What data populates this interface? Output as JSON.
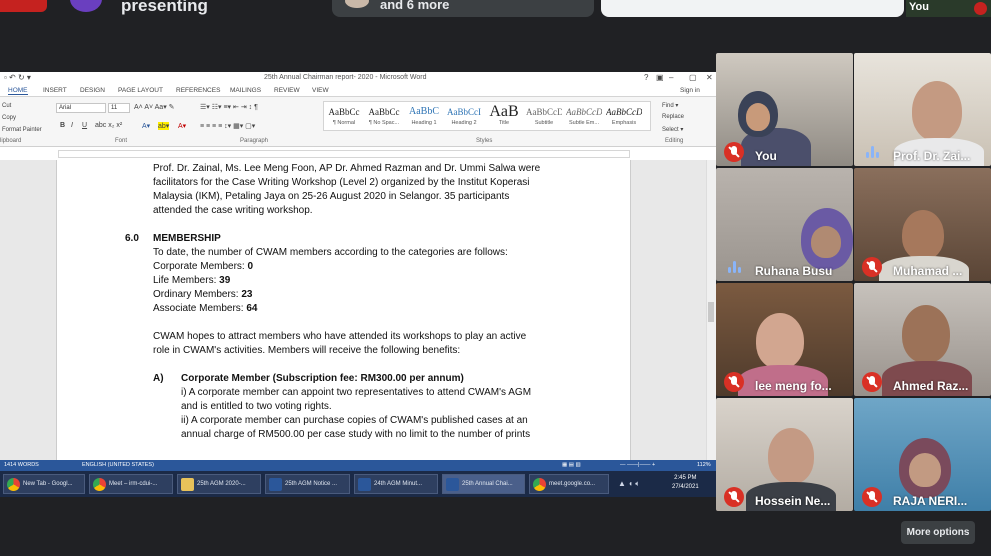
{
  "meet": {
    "presenting_label": "presenting",
    "participants_more": "and 6 more",
    "self_mini_label": "You",
    "more_options_label": "More options"
  },
  "word": {
    "title": "25th Annual Chairman report- 2020 - Microsoft Word",
    "window_controls": [
      "?",
      "▣",
      "–",
      "▢",
      "✕"
    ],
    "sign_in": "Sign in",
    "tabs": [
      "HOME",
      "INSERT",
      "DESIGN",
      "PAGE LAYOUT",
      "REFERENCES",
      "MAILINGS",
      "REVIEW",
      "VIEW"
    ],
    "clipboard": [
      "Cut",
      "Copy",
      "Format Painter"
    ],
    "font_name": "Arial",
    "font_size": "11",
    "styles": [
      {
        "preview": "AaBbCc",
        "name": "¶ Normal"
      },
      {
        "preview": "AaBbCc",
        "name": "¶ No Spac..."
      },
      {
        "preview": "AaBbC",
        "name": "Heading 1"
      },
      {
        "preview": "AaBbCcI",
        "name": "Heading 2"
      },
      {
        "preview": "AaB",
        "name": "Title"
      },
      {
        "preview": "AaBbCcD",
        "name": "Subtitle"
      },
      {
        "preview": "AaBbCcD",
        "name": "Subtle Em..."
      },
      {
        "preview": "AaBbCcD",
        "name": "Emphasis"
      }
    ],
    "editing": [
      "Find ▾",
      "Replace",
      "Select ▾"
    ],
    "groups": [
      "lipboard",
      "Font",
      "Paragraph",
      "Styles",
      "Editing"
    ],
    "status": {
      "words": "1414 WORDS",
      "language": "ENGLISH (UNITED STATES)",
      "zoom": "112%"
    }
  },
  "document": {
    "lines": [
      "Prof. Dr. Zainal, Ms. Lee Meng Foon, AP Dr. Ahmed Razman and Dr. Ummi Salwa were",
      "facilitators for the Case Writing Workshop (Level 2) organized by the Institut Koperasi",
      "Malaysia (IKM), Petaling Jaya on 25-26 August 2020 in Selangor. 35 participants",
      "attended the case writing workshop."
    ],
    "section_number": "6.0",
    "section_title": "MEMBERSHIP",
    "intro": "To date, the number of CWAM members according to the categories are follows:",
    "members": [
      {
        "label": "Corporate Members: ",
        "value": "0"
      },
      {
        "label": "Life Members: ",
        "value": "39"
      },
      {
        "label": "Ordinary Members: ",
        "value": "23"
      },
      {
        "label": "Associate Members: ",
        "value": "64"
      }
    ],
    "hope_lines": [
      "CWAM hopes to attract members who have attended its workshops to play an active",
      "role in CWAM's activities. Members will receive the following benefits:"
    ],
    "item_letter": "A)",
    "item_title": "Corporate Member (Subscription fee: RM300.00 per annum)",
    "benefits": [
      "i)  A corporate member can appoint two representatives to attend CWAM's AGM",
      "and is entitled to two voting rights.",
      "ii)  A corporate member can purchase copies of CWAM's published cases at an",
      "annual charge of RM500.00 per case study with no limit to the number of prints"
    ]
  },
  "taskbar": {
    "items": [
      {
        "label": "New Tab - Googl...",
        "icon": "chrome-icon"
      },
      {
        "label": "Meet – irm-cdui-...",
        "icon": "chrome-icon"
      },
      {
        "label": "25th AGM 2020-...",
        "icon": "folder-icon"
      },
      {
        "label": "25th AGM Notice ...",
        "icon": "word-icon"
      },
      {
        "label": "24th AGM Minut...",
        "icon": "word-icon"
      },
      {
        "label": "25th Annual Chai...",
        "icon": "word-icon"
      },
      {
        "label": "meet.google.co...",
        "icon": "chrome-icon"
      }
    ],
    "time": "2:45 PM",
    "date": "27/4/2021"
  },
  "participants": [
    {
      "name": "You",
      "muted": true
    },
    {
      "name": "Prof. Dr. Zai...",
      "muted": false
    },
    {
      "name": "Ruhana Busu",
      "muted": false
    },
    {
      "name": "Muhamad ...",
      "muted": true
    },
    {
      "name": "lee meng fo...",
      "muted": true
    },
    {
      "name": "Ahmed Raz...",
      "muted": true
    },
    {
      "name": "Hossein Ne...",
      "muted": true
    },
    {
      "name": "RAJA NERI...",
      "muted": true
    }
  ],
  "colors": {
    "meet_bg": "#202124",
    "word_blue": "#2b579a",
    "mute_red": "#d93025",
    "speaking_blue": "#8ab4f8"
  }
}
